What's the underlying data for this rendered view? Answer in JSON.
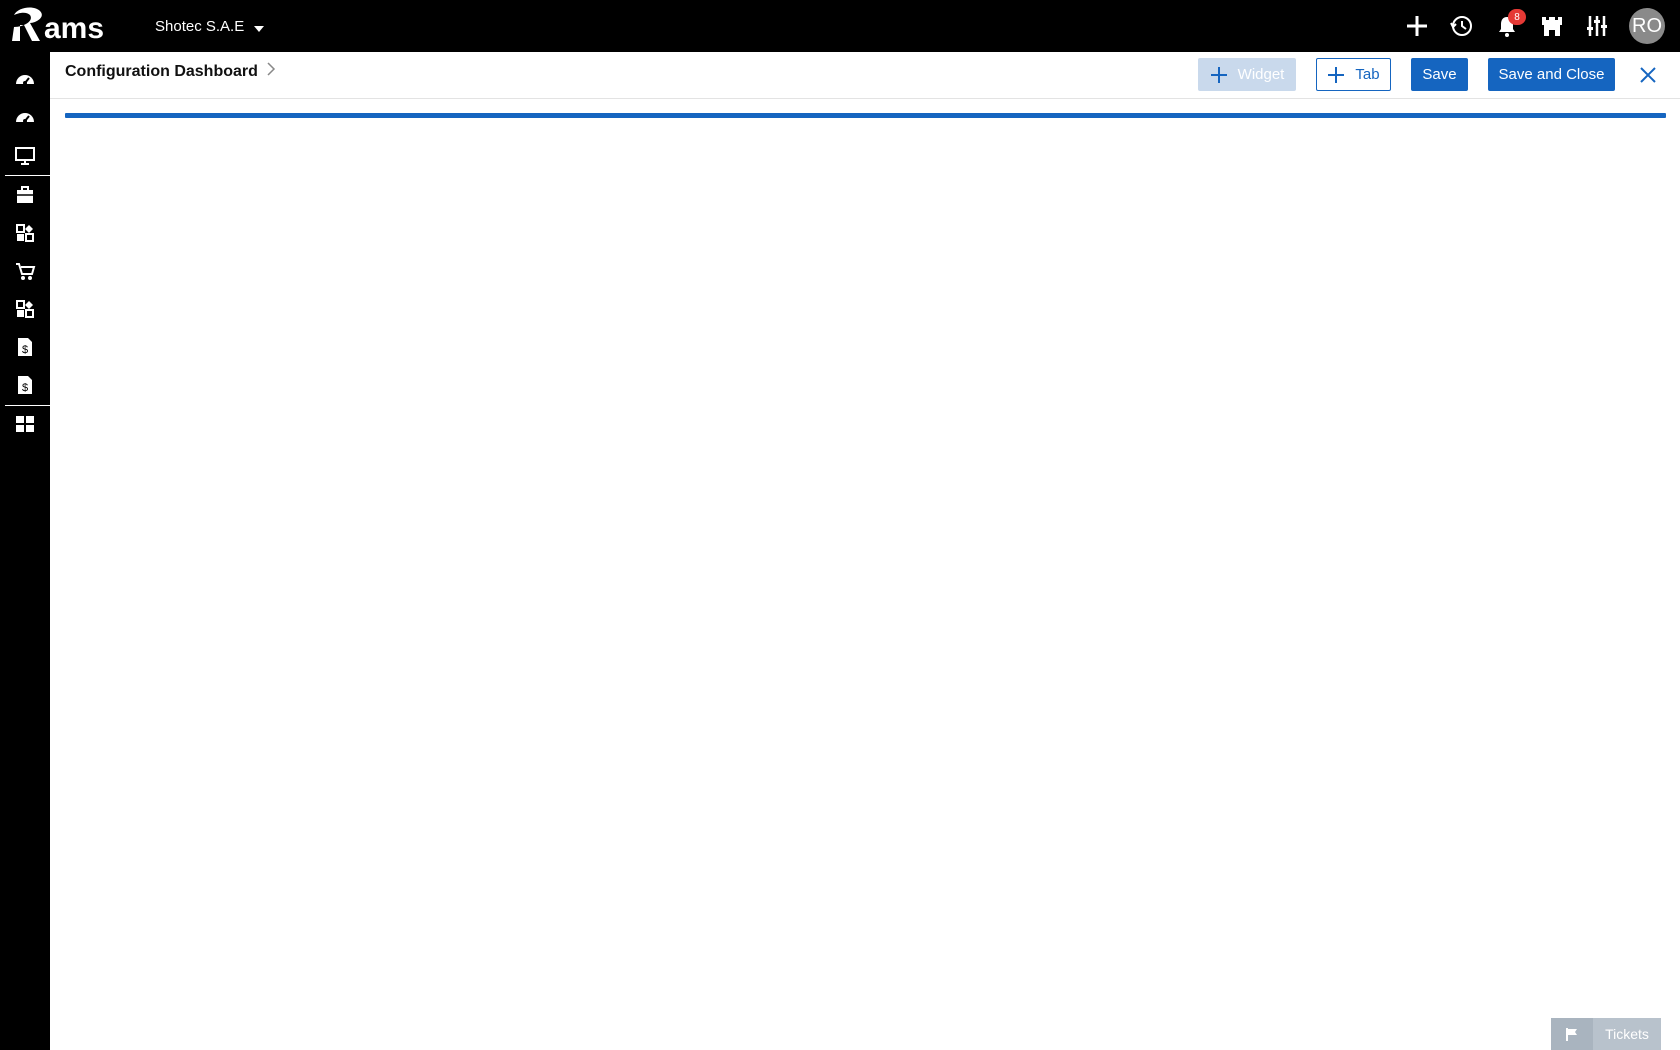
{
  "app": {
    "logo_text": "Rams",
    "company": "Shotec S.A.E",
    "notifications_count": "8",
    "user_initials": "RO"
  },
  "topbar": {
    "icons": [
      "plus-icon",
      "history-icon",
      "bell-icon",
      "castle-icon",
      "sliders-icon"
    ]
  },
  "sidebar": {
    "items": [
      "dashboard-icon",
      "dashboard-icon",
      "monitor-icon",
      "briefcase-icon",
      "widgets-icon",
      "cart-icon",
      "widgets-icon",
      "invoice-icon",
      "invoice-icon",
      "layout-icon"
    ]
  },
  "header": {
    "title": "Configuration Dashboard",
    "widget_label": "Widget",
    "tab_label": "Tab",
    "save_label": "Save",
    "save_close_label": "Save and Close"
  },
  "footer": {
    "tickets_label": "Tickets"
  },
  "colors": {
    "primary": "#1565c0",
    "topbar": "#000000",
    "badge": "#e53935",
    "widget_disabled": "#c9d9ec"
  }
}
